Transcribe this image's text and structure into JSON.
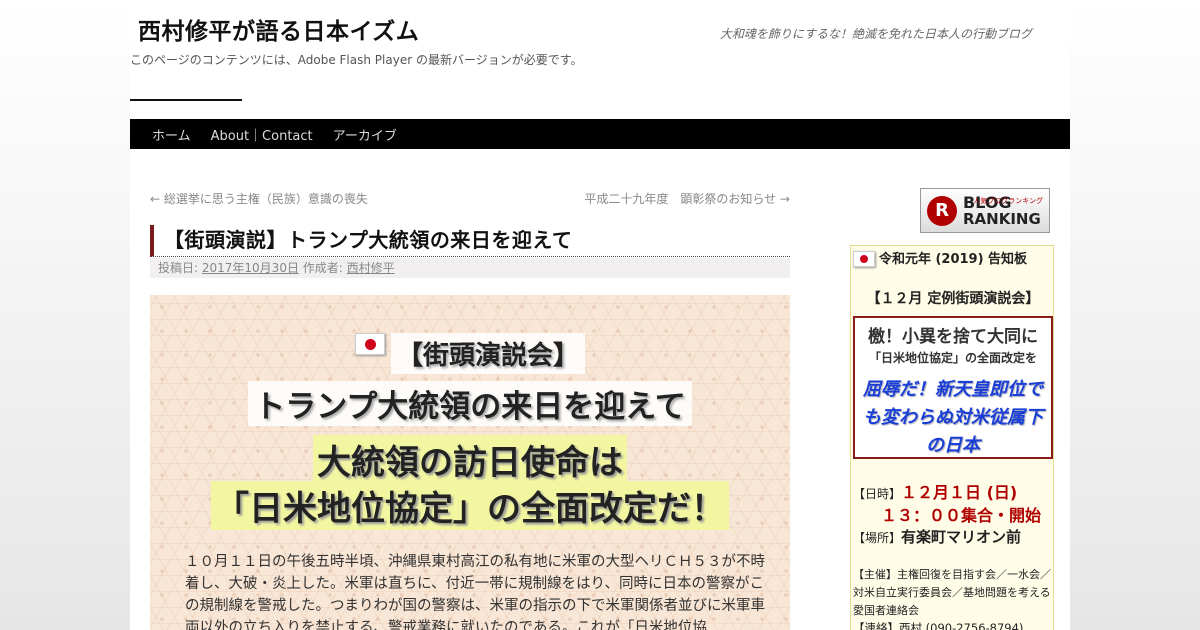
{
  "header": {
    "site_title": "西村修平が語る日本イズム",
    "site_description": "大和魂を飾りにするな！絶滅を免れた日本人の行動ブログ",
    "flash_notice": "このページのコンテンツには、Adobe Flash Player の最新バージョンが必要です。"
  },
  "nav": {
    "items": [
      {
        "label": "ホーム"
      },
      {
        "label": "About｜Contact"
      },
      {
        "label": "アーカイブ"
      }
    ]
  },
  "post_navigation": {
    "prev": "← 総選挙に思う主権（民族）意識の喪失",
    "next": "平成二十九年度　顕彰祭のお知らせ →"
  },
  "post": {
    "title": "【街頭演説】トランプ大統領の来日を迎えて",
    "meta_posted_prefix": "投稿日:",
    "meta_date": "2017年10月30日",
    "meta_author_prefix": "作成者:",
    "meta_author": "西村修平",
    "hero_line1": "【街頭演説会】",
    "hero_line2": "トランプ大統領の来日を迎えて",
    "hero_line3": "大統領の訪日使命は",
    "hero_line4": "「日米地位協定」の全面改定だ！",
    "body_text": "１０月１１日の午後五時半頃、沖縄県東村高江の私有地に米軍の大型ヘリＣＨ５３が不時着し、大破・炎上した。米軍は直ちに、付近一帯に規制線をはり、同時に日本の警察がこの規制線を警戒した。つまりわが国の警察は、米軍の指示の下で米軍関係者並びに米軍車両以外の立ち入りを禁止する、警戒業務に就いたのである。これが「日米地位協"
  },
  "sidebar": {
    "ranking_banner": {
      "letter": "R",
      "line1": "BLOG",
      "line2": "RANKING",
      "small": "人気ブログランキング"
    },
    "notice": {
      "heading": "令和元年 (2019) 告知板",
      "subheading": "【１２月 定例街頭演説会】",
      "box_line1": "檄！小異を捨て大同に",
      "box_line2": "「日米地位協定」の全面改定を",
      "box_line3": "屈辱だ！新天皇即位でも変わらぬ対米従属下の日本",
      "date_label": "【日時】",
      "date_value": "１２月１日 (日)",
      "time_value": "１３：００集合・開始",
      "place_label": "【場所】",
      "place_value": "有楽町マリオン前",
      "organizer": "【主催】主権回復を目指す会／一水会／対米自立実行委員会／基地問題を考える愛国者連絡会",
      "contact": "【連絡】西村 (090-2756-8794)"
    }
  },
  "colors": {
    "nav_bg": "#000000",
    "title_accent": "#7a1c1c",
    "highlight_yellow": "#f3f6a0",
    "notice_blue": "#1a3fd6",
    "notice_red": "#b00000"
  }
}
